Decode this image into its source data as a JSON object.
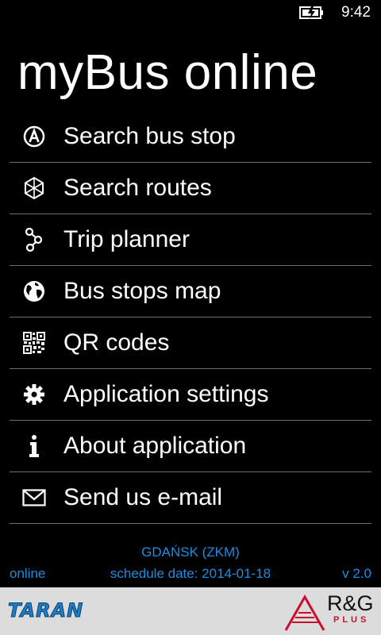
{
  "status_bar": {
    "time": "9:42",
    "battery_icon": "battery-charging-icon"
  },
  "app": {
    "title": "myBus online"
  },
  "menu": {
    "items": [
      {
        "label": "Search bus stop",
        "icon": "bus-stop-icon"
      },
      {
        "label": "Search routes",
        "icon": "routes-icon"
      },
      {
        "label": "Trip planner",
        "icon": "trip-planner-icon"
      },
      {
        "label": "Bus stops map",
        "icon": "globe-icon"
      },
      {
        "label": "QR codes",
        "icon": "qr-code-icon"
      },
      {
        "label": "Application settings",
        "icon": "gear-icon"
      },
      {
        "label": "About application",
        "icon": "info-icon"
      },
      {
        "label": "Send us e-mail",
        "icon": "mail-icon"
      }
    ]
  },
  "footer": {
    "city": "GDAŃSK (ZKM)",
    "online": "online",
    "schedule_date": "schedule date: 2014-01-18",
    "version": "v 2.0"
  },
  "logos": {
    "taran": "TARAN",
    "rg": "R&G",
    "rg_sub": "PLUS"
  },
  "colors": {
    "accent": "#1b8de0",
    "background": "#000000",
    "divider": "#6f6f6f",
    "logo_bar": "#dcdcdc"
  }
}
